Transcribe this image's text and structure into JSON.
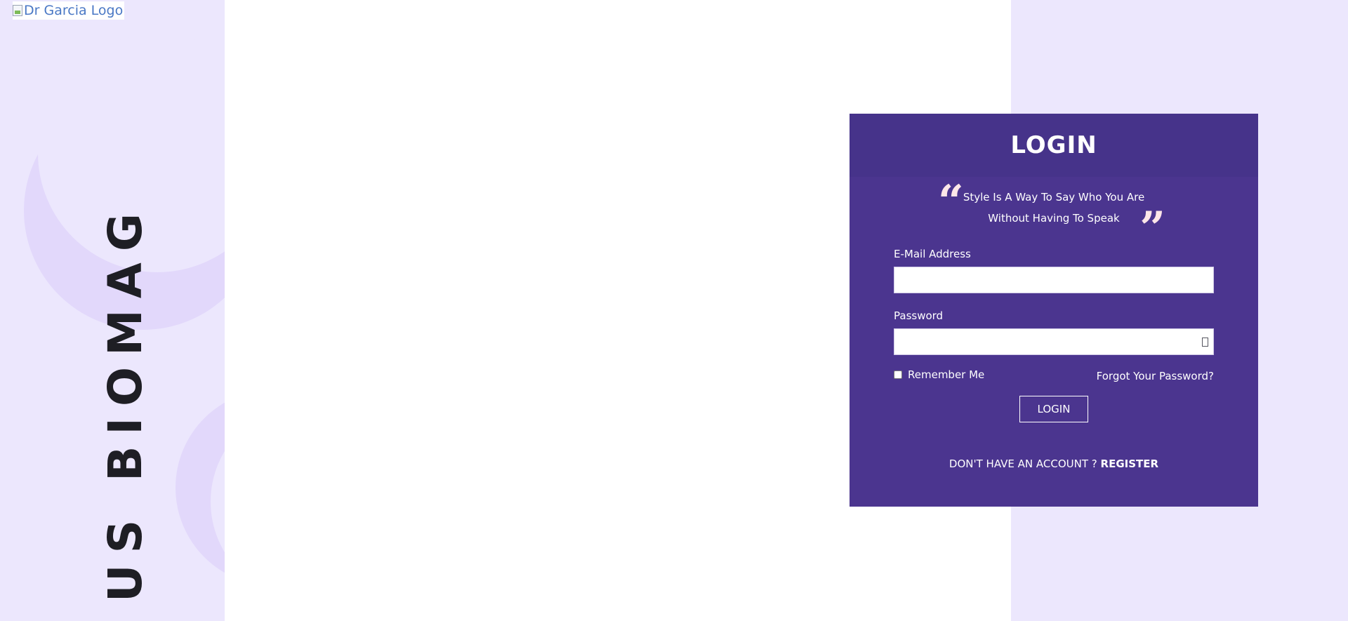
{
  "brand": {
    "logo_alt": "Dr Garcia Logo",
    "vertical_text": "US BIOMAG"
  },
  "login": {
    "title": "LOGIN",
    "quote_line1": "Style Is A Way To Say Who You Are",
    "quote_line2": "Without Having To Speak",
    "quote_open": "“",
    "quote_close": "”",
    "email_label": "E-Mail Address",
    "email_value": "",
    "password_label": "Password",
    "password_value": "",
    "remember_label": "Remember Me",
    "remember_checked": false,
    "forgot_label": "Forgot Your Password?",
    "button_label": "LOGIN",
    "register_prompt": "DON'T HAVE AN ACCOUNT ?",
    "register_link": "REGISTER"
  },
  "icons": {
    "logo": "broken-image-icon",
    "password_toggle": "eye-icon",
    "quote_open": "quote-open-icon",
    "quote_close": "quote-close-icon"
  },
  "colors": {
    "page_background": "#ece7fd",
    "card_background": "#4b358f",
    "card_header": "#46338a",
    "decor_circle": "#e2d8fb",
    "quote_marks": "#fde6e8",
    "text_light": "#ffffff",
    "brand_text": "#1e1e24"
  }
}
